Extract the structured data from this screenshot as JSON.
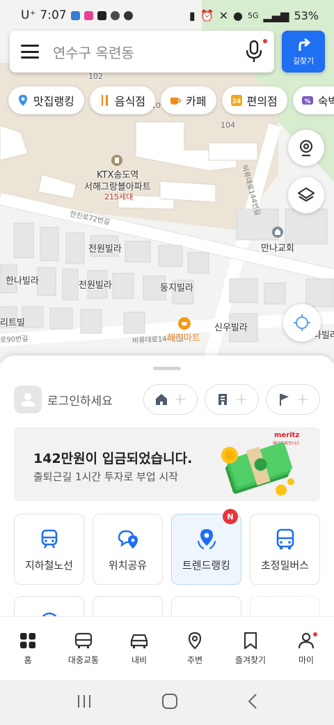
{
  "status_bar": {
    "carrier": "U⁺",
    "time": "7:07",
    "network": "5G",
    "battery": "53%"
  },
  "search": {
    "query": "연수구 옥련동",
    "directions_label": "길찾기"
  },
  "chips": [
    {
      "label": "맛집랭킹",
      "icon": "location-fire-icon",
      "color": "#3b8ef0"
    },
    {
      "label": "음식점",
      "icon": "utensils-icon",
      "color": "#f08a1c"
    },
    {
      "label": "카페",
      "icon": "coffee-cup-icon",
      "color": "#f08a1c"
    },
    {
      "label": "편의점",
      "icon": "24-hour-icon",
      "color": "#f0a81c"
    },
    {
      "label": "숙박",
      "icon": "percent-tag-icon",
      "color": "#7e57c2"
    }
  ],
  "map": {
    "labels": {
      "building_102": "102",
      "building_104": "104",
      "building_10x": "10",
      "apt_name_line1": "KTX송도역",
      "apt_name_line2": "서해그랑블아파트",
      "apt_units": "215세대",
      "road_hanjin72": "한진로72번길",
      "road_side": "비류대로144번길",
      "road_vertical": "비류대로144번길",
      "road_90": "로90번길",
      "villa_1": "전원빌라",
      "villa_2": "한나빌라",
      "villa_3": "전원빌라",
      "villa_4": "둥지빌라",
      "villa_5": "신우빌라",
      "villa_6": "리트빌",
      "villa_7": "나빌라",
      "church": "만나교회",
      "mart": "해진마트"
    }
  },
  "sheet": {
    "login_prompt": "로그인하세요",
    "shortcuts": [
      {
        "icon": "home-icon",
        "plus": "+"
      },
      {
        "icon": "building-icon",
        "plus": "+"
      },
      {
        "icon": "flag-icon",
        "plus": "+"
      }
    ],
    "ad": {
      "title": "142만원이 입금되었습니다.",
      "subtitle": "출퇴근길 1시간 투자로 부업 시작",
      "brand": "meritz",
      "brand_sub": "메리츠파트너스"
    },
    "tiles": [
      {
        "label": "지하철노선",
        "icon": "subway-icon"
      },
      {
        "label": "위치공유",
        "icon": "location-share-icon"
      },
      {
        "label": "트렌드랭킹",
        "icon": "trend-ranking-icon",
        "badge": "N",
        "selected": true
      },
      {
        "label": "초정밀버스",
        "icon": "bus-icon"
      }
    ]
  },
  "bottom_nav": [
    {
      "label": "홈",
      "icon": "home-grid-icon"
    },
    {
      "label": "대중교통",
      "icon": "bus-front-icon"
    },
    {
      "label": "내비",
      "icon": "car-icon"
    },
    {
      "label": "주변",
      "icon": "map-pin-icon"
    },
    {
      "label": "즐겨찾기",
      "icon": "bookmark-icon"
    },
    {
      "label": "마이",
      "icon": "person-icon"
    }
  ],
  "colors": {
    "brand_blue": "#1f6ff3",
    "badge_red": "#e8343d",
    "apartment_fill": "#ece4d6",
    "green_area": "#d8ecd0"
  }
}
